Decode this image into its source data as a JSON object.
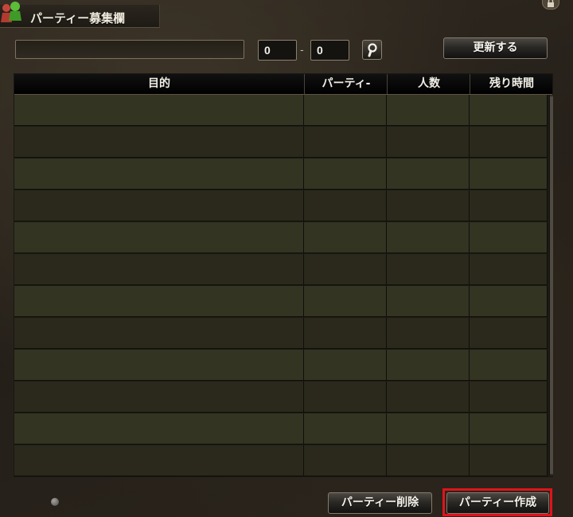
{
  "window": {
    "title": "パーティー募集欄"
  },
  "search": {
    "keyword_value": "",
    "keyword_placeholder": "",
    "level_min": "0",
    "range_separator": "-",
    "level_max": "0",
    "refresh_label": "更新する"
  },
  "table": {
    "columns": [
      "目的",
      "パーティ-",
      "人数",
      "残り時間"
    ],
    "rows": [
      [
        "",
        "",
        "",
        ""
      ],
      [
        "",
        "",
        "",
        ""
      ],
      [
        "",
        "",
        "",
        ""
      ],
      [
        "",
        "",
        "",
        ""
      ],
      [
        "",
        "",
        "",
        ""
      ],
      [
        "",
        "",
        "",
        ""
      ],
      [
        "",
        "",
        "",
        ""
      ],
      [
        "",
        "",
        "",
        ""
      ],
      [
        "",
        "",
        "",
        ""
      ],
      [
        "",
        "",
        "",
        ""
      ],
      [
        "",
        "",
        "",
        ""
      ],
      [
        "",
        "",
        "",
        ""
      ]
    ]
  },
  "footer": {
    "delete_label": "パーティー削除",
    "create_label": "パーティー作成"
  },
  "icons": {
    "app": "party-members-icon",
    "search": "magnifier-icon",
    "lock": "lock-icon"
  },
  "colors": {
    "highlight": "#e0131b",
    "row_odd": "#46482c",
    "row_even": "#343422"
  }
}
